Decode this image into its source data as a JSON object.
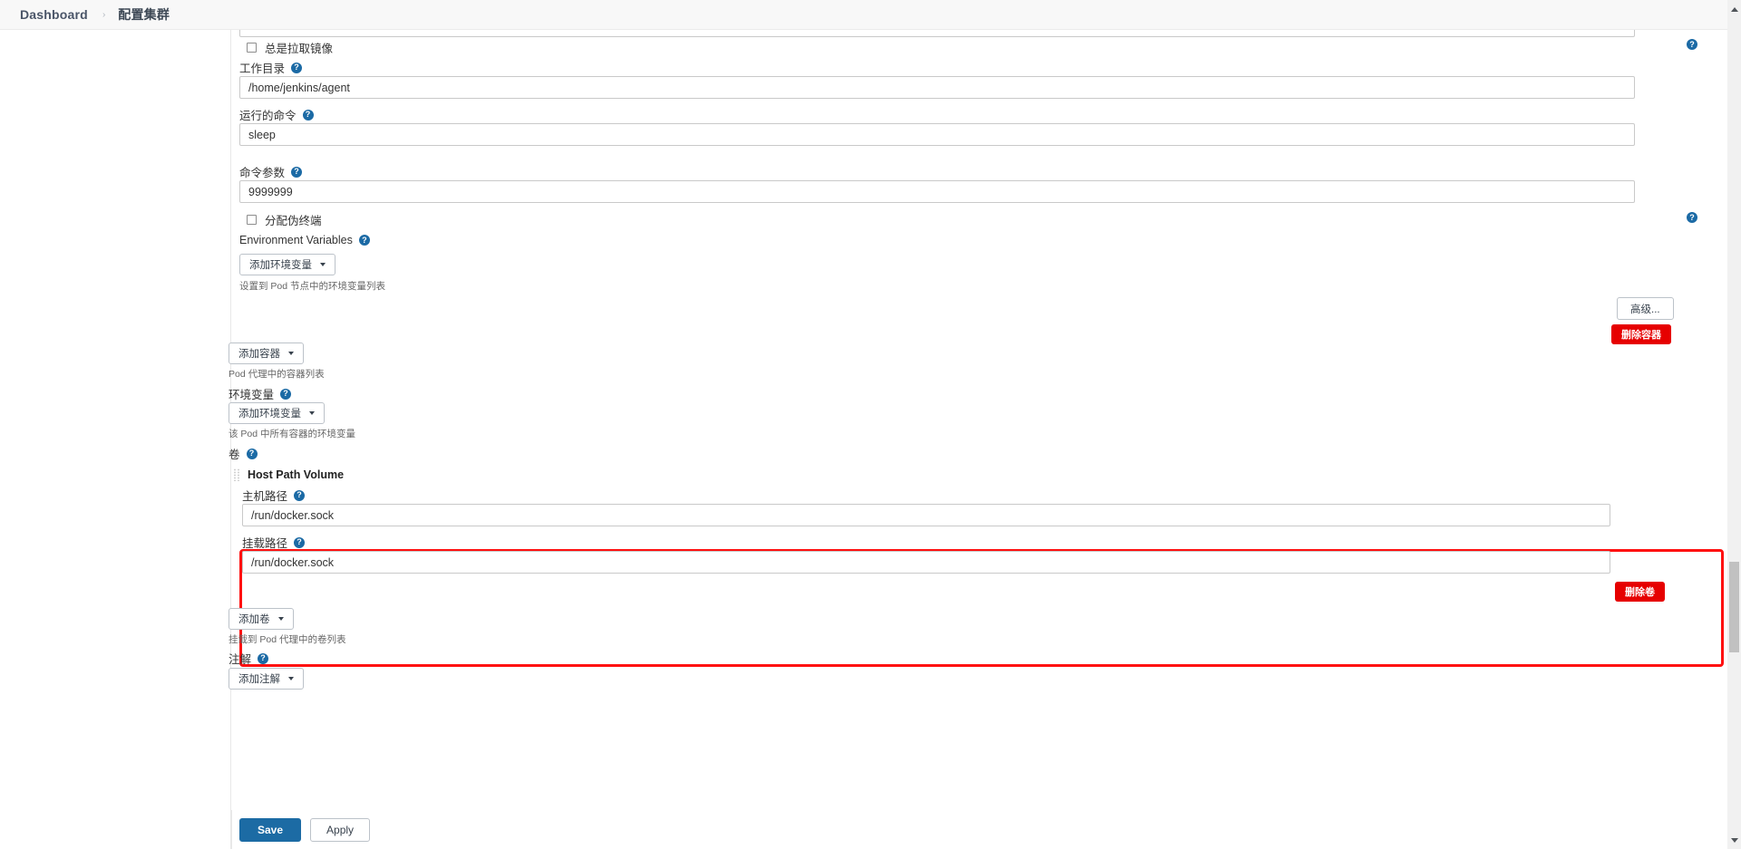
{
  "breadcrumb": {
    "items": [
      {
        "label": "Dashboard"
      },
      {
        "label": "配置集群"
      }
    ],
    "separator": "›"
  },
  "icons": {
    "help": "?",
    "drag_grip": "drag-grip-icon",
    "caret_down": "chevron-down-icon"
  },
  "colors": {
    "accent": "#1c6ba4",
    "danger": "#e60000",
    "highlight_border": "#ff1010",
    "help_badge": "#1b6aa5"
  },
  "container_section": {
    "always_pull": {
      "label": "总是拉取镜像",
      "checked": false
    },
    "working_dir": {
      "label": "工作目录",
      "value": "/home/jenkins/agent",
      "placeholder": ""
    },
    "command": {
      "label": "运行的命令",
      "value": "sleep",
      "placeholder": ""
    },
    "args": {
      "label": "命令参数",
      "value": "9999999",
      "placeholder": ""
    },
    "allocate_tty": {
      "label": "分配伪终端",
      "checked": false
    },
    "env_vars": {
      "label": "Environment Variables",
      "add_button": "添加环境变量",
      "hint": "设置到 Pod 节点中的环境变量列表"
    },
    "advanced_button": "高级...",
    "delete_container_button": "删除容器"
  },
  "pod_section": {
    "add_container": {
      "button": "添加容器",
      "hint": "Pod 代理中的容器列表"
    },
    "env_vars": {
      "label": "环境变量",
      "add_button": "添加环境变量",
      "hint": "该 Pod 中所有容器的环境变量"
    },
    "volumes_label": "卷"
  },
  "host_path_volume": {
    "title": "Host Path Volume",
    "host_path": {
      "label": "主机路径",
      "value": "/run/docker.sock",
      "placeholder": ""
    },
    "mount_path": {
      "label": "挂载路径",
      "value": "/run/docker.sock",
      "placeholder": ""
    },
    "delete_button": "删除卷"
  },
  "volumes_footer": {
    "add_volume_button": "添加卷",
    "hint": "挂载到 Pod 代理中的卷列表",
    "annotations_label": "注解",
    "add_annotation_button": "添加注解"
  },
  "form_actions": {
    "save": "Save",
    "apply": "Apply"
  }
}
